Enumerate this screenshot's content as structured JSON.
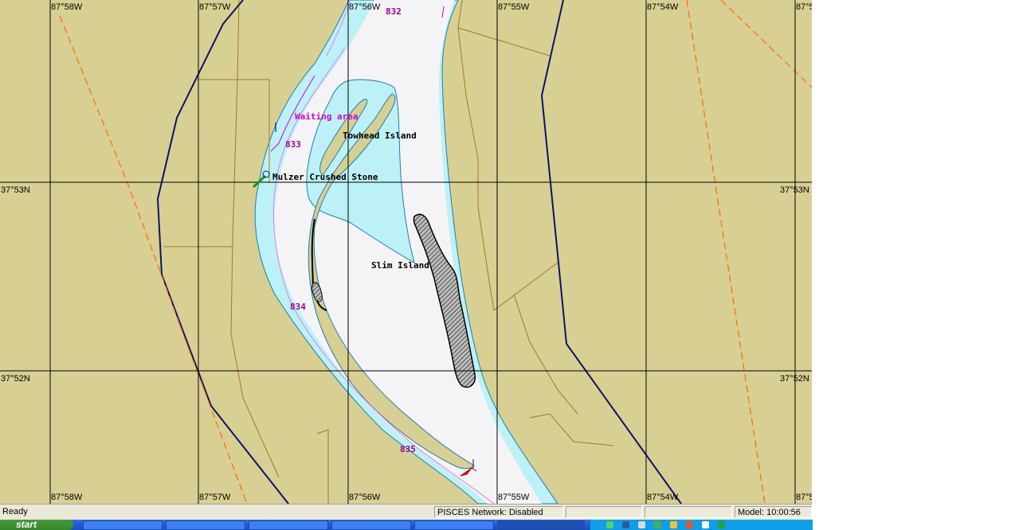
{
  "map": {
    "longitude_labels": [
      "87°58W",
      "87°57W",
      "87°56W",
      "87°55W",
      "87°54W",
      "87°5"
    ],
    "latitude_labels": [
      "37°53N",
      "37°52N"
    ],
    "mile_markers": [
      "832",
      "833",
      "834",
      "835"
    ],
    "area_label": "Waiting area",
    "place_labels": {
      "towhead": "Towhead Island",
      "mulzer": "Mulzer Crushed Stone",
      "slim": "Slim Island"
    },
    "colors": {
      "land": "#d8cf93",
      "shallow_water": "#bcf1f7",
      "channel": "#f4f4f6",
      "grid": "#000000",
      "magenta_label": "#990099",
      "boundary_navy": "#0c1468",
      "dashed_orange": "#ff6a00",
      "contour_brown": "#a07d1a"
    }
  },
  "status_bar": {
    "ready": "Ready",
    "network": "PISCES Network: Disabled",
    "model": "Model: 10:00:56"
  },
  "taskbar": {
    "start_label": "start"
  }
}
